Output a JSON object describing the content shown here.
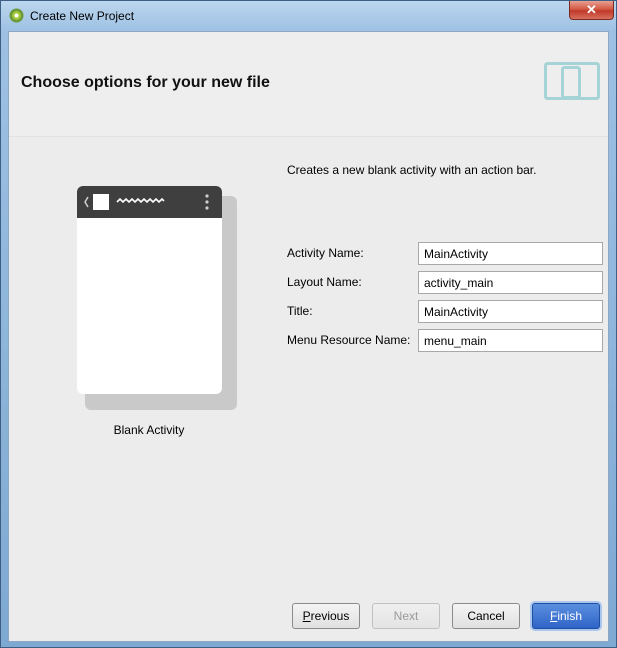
{
  "window": {
    "title": "Create New Project",
    "close_glyph": "✕"
  },
  "header": {
    "title": "Choose options for your new file"
  },
  "template": {
    "label": "Blank Activity"
  },
  "description": "Creates a new blank activity with an action bar.",
  "form": {
    "activity_name": {
      "label": "Activity Name:",
      "value": "MainActivity"
    },
    "layout_name": {
      "label": "Layout Name:",
      "value": "activity_main"
    },
    "title": {
      "label": "Title:",
      "value": "MainActivity"
    },
    "menu_resource_name": {
      "label": "Menu Resource Name:",
      "value": "menu_main"
    }
  },
  "buttons": {
    "previous": {
      "mnemonic": "P",
      "rest": "revious"
    },
    "next": "Next",
    "cancel": "Cancel",
    "finish": {
      "mnemonic": "F",
      "rest": "inish"
    }
  },
  "colors": {
    "accent": "#2f64c8",
    "action_bar": "#3f3f3f",
    "device_icon": "#a6d4d6"
  },
  "icons": [
    "android-studio-icon",
    "close-icon",
    "device-icon",
    "back-chevron-icon",
    "overflow-menu-icon"
  ]
}
